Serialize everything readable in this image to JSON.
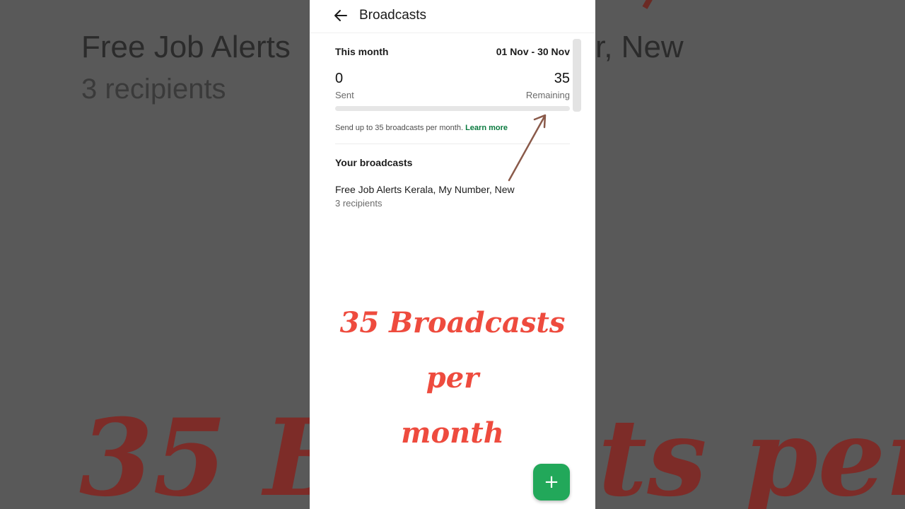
{
  "header": {
    "title": "Broadcasts"
  },
  "summary": {
    "period_label": "This month",
    "period_range": "01 Nov - 30 Nov",
    "sent_value": "0",
    "sent_label": "Sent",
    "remaining_value": "35",
    "remaining_label": "Remaining",
    "progress_fraction": 0,
    "info_text": "Send up to 35 broadcasts per month.",
    "learn_more": "Learn more"
  },
  "broadcasts": {
    "section_title": "Your broadcasts",
    "items": [
      {
        "name": "Free Job Alerts Kerala, My Number, New",
        "recipients": "3 recipients"
      }
    ]
  },
  "overlay": {
    "line1": "35 Broadcasts per",
    "line2": "month"
  },
  "background": {
    "title_left": "Free Job Alerts",
    "title_right": "r, New",
    "subtitle": "3 recipients",
    "big_left": "35 Br",
    "big_right": "ts per"
  },
  "colors": {
    "accent_green": "#22a85a",
    "overlay_red": "#ee4b3e",
    "arrow_brown": "#8a5a4a"
  },
  "icons": {
    "back": "arrow-left-icon",
    "fab": "plus-icon"
  }
}
